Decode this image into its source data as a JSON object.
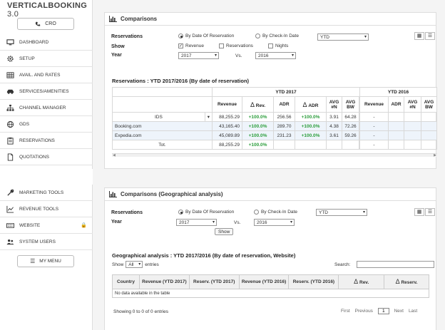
{
  "logo": {
    "bold": "VERTICALBOOKING",
    "light": " 3.0"
  },
  "cro_label": "CRO",
  "nav_top": [
    {
      "label": "DASHBOARD",
      "icon": "monitor-icon"
    },
    {
      "label": "SETUP",
      "icon": "gear-icon"
    },
    {
      "label": "AVAIL. AND RATES",
      "icon": "grid-icon"
    },
    {
      "label": "SERVICES/AMENITIES",
      "icon": "car-icon"
    },
    {
      "label": "CHANNEL MANAGER",
      "icon": "sitemap-icon"
    },
    {
      "label": "GDS",
      "icon": "globe-icon"
    },
    {
      "label": "RESERVATIONS",
      "icon": "clipboard-icon"
    },
    {
      "label": "QUOTATIONS",
      "icon": "document-icon"
    }
  ],
  "nav_bottom": [
    {
      "label": "MARKETING TOOLS",
      "icon": "wrench-icon"
    },
    {
      "label": "REVENUE TOOLS",
      "icon": "line-chart-icon"
    },
    {
      "label": "WEBSITE",
      "icon": "keyboard-icon"
    },
    {
      "label": "SYSTEM USERS",
      "icon": "users-icon"
    }
  ],
  "my_menu_label": "MY MENU",
  "panel1": {
    "title": "Comparisons",
    "reservations_label": "Reservations",
    "radio_by_date": "By Date Of Reservation",
    "radio_by_checkin": "By Check-In Date",
    "period_select": "YTD",
    "show_label": "Show",
    "chk_revenue": "Revenue",
    "chk_reservations": "Reservations",
    "chk_nights": "Nights",
    "year_label": "Year",
    "year_a": "2017",
    "vs_label": "Vs.",
    "year_b": "2016",
    "section_title": "Reservations : YTD 2017/2016 (By date of reservation)",
    "group_2017": "YTD 2017",
    "group_2016": "YTD 2016",
    "cols_2017": [
      "Revenue",
      "Rev.",
      "ADR",
      "ADR",
      "AVG #N",
      "AVG BW"
    ],
    "delta_symbol": "Δ",
    "cols_2016": [
      "Revenue",
      "ADR",
      "AVG #N",
      "AVG BW"
    ],
    "rows": [
      {
        "name": "IDS",
        "revenue": "88,255.29",
        "drev": "+100.0%",
        "adr": "256.56",
        "dadr": "+100.0%",
        "avgn": "3.91",
        "avgbw": "64.28",
        "rev16": "-"
      },
      {
        "name": "Booking.com",
        "revenue": "43,165.40",
        "drev": "+100.0%",
        "adr": "289.70",
        "dadr": "+100.0%",
        "avgn": "4.38",
        "avgbw": "72.26",
        "rev16": "-"
      },
      {
        "name": "Expedia.com",
        "revenue": "45,089.89",
        "drev": "+100.0%",
        "adr": "231.23",
        "dadr": "+100.0%",
        "avgn": "3.61",
        "avgbw": "59.26",
        "rev16": "-"
      },
      {
        "name": "Tot.",
        "revenue": "88,255.29",
        "drev": "+100.0%",
        "adr": "",
        "dadr": "",
        "avgn": "",
        "avgbw": "",
        "rev16": "-"
      }
    ]
  },
  "panel2": {
    "title": "Comparisons (Geographical analysis)",
    "reservations_label": "Reservations",
    "radio_by_date": "By Date Of Reservation",
    "radio_by_checkin": "By Check-In Date",
    "period_select": "YTD",
    "year_label": "Year",
    "year_a": "2017",
    "vs_label": "Vs.",
    "year_b": "2016",
    "show_button": "Show",
    "section_title": "Geographical analysis : YTD 2017/2016 (By date of reservation, Website)",
    "show_entries_pre": "Show",
    "entries_select": "All",
    "show_entries_post": "entries",
    "search_label": "Search:",
    "columns": [
      "Country",
      "Revenue (YTD 2017)",
      "Reserv. (YTD 2017)",
      "Revenue (YTD 2016)",
      "Reserv. (YTD 2016)",
      "Rev.",
      "Reserv."
    ],
    "empty_text": "No data available in the table",
    "info_text": "Showing 0 to 0 of 0 entries",
    "pager": {
      "first": "First",
      "previous": "Previous",
      "current": "1",
      "next": "Next",
      "last": "Last"
    }
  }
}
